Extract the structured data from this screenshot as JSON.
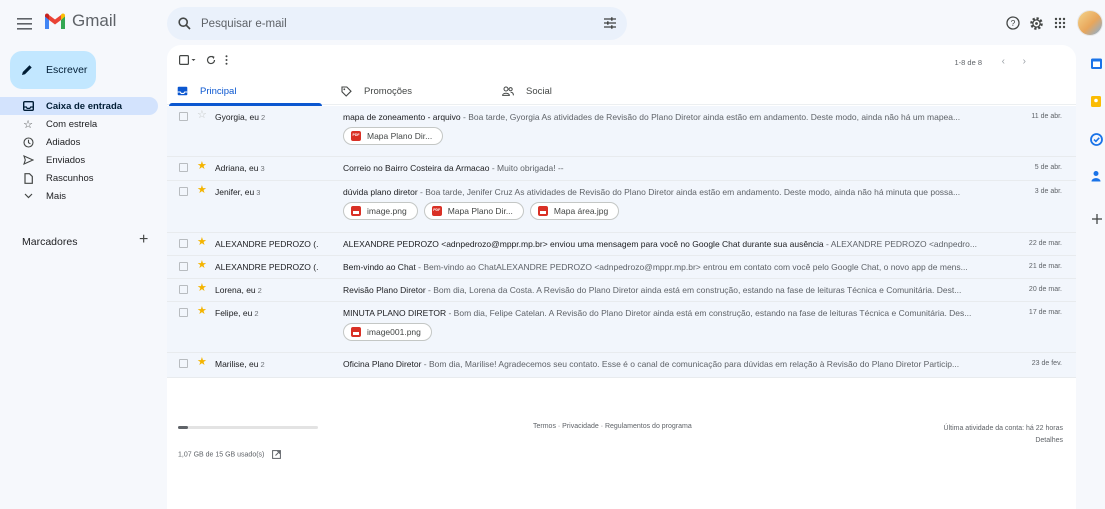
{
  "app": {
    "logo_text": "Gmail"
  },
  "search": {
    "placeholder": "Pesquisar e-mail"
  },
  "compose": {
    "label": "Escrever"
  },
  "nav": [
    {
      "label": "Caixa de entrada",
      "icon": "inbox-icon",
      "active": true
    },
    {
      "label": "Com estrela",
      "icon": "star-icon"
    },
    {
      "label": "Adiados",
      "icon": "clock-icon"
    },
    {
      "label": "Enviados",
      "icon": "send-icon"
    },
    {
      "label": "Rascunhos",
      "icon": "draft-icon"
    },
    {
      "label": "Mais",
      "icon": "chevron-down-icon"
    }
  ],
  "labels": {
    "heading": "Marcadores",
    "add": "+"
  },
  "toolbar": {
    "pager": "1-8 de 8"
  },
  "tabs": [
    {
      "label": "Principal",
      "icon": "inbox-icon",
      "active": true
    },
    {
      "label": "Promoções",
      "icon": "tag-icon"
    },
    {
      "label": "Social",
      "icon": "people-icon"
    }
  ],
  "emails": [
    {
      "sender": "Gyorgia, eu",
      "count": "2",
      "starred": false,
      "subject": "mapa de zoneamento - arquivo",
      "snippet": " - Boa tarde, Gyorgia As atividades de Revisão do Plano Diretor ainda estão em andamento. Deste modo, ainda não há um mapea...",
      "date": "11 de abr.",
      "attachments": [
        {
          "name": "Mapa Plano Dir...",
          "type": "pdf"
        }
      ]
    },
    {
      "sender": "Adriana, eu",
      "count": "3",
      "starred": true,
      "subject": "Correio no Bairro Costeira da Armacao",
      "snippet": " - Muito obrigada! --",
      "date": "5 de abr.",
      "attachments": []
    },
    {
      "sender": "Jenifer, eu",
      "count": "3",
      "starred": true,
      "subject": "dúvida plano diretor",
      "snippet": " - Boa tarde, Jenifer Cruz As atividades de Revisão do Plano Diretor ainda estão em andamento. Deste modo, ainda não há minuta que possa...",
      "date": "3 de abr.",
      "attachments": [
        {
          "name": "image.png",
          "type": "img"
        },
        {
          "name": "Mapa Plano Dir...",
          "type": "pdf"
        },
        {
          "name": "Mapa área.jpg",
          "type": "img"
        }
      ]
    },
    {
      "sender": "ALEXANDRE PEDROZO (.",
      "count": "",
      "starred": true,
      "subject": "ALEXANDRE PEDROZO <adnpedrozo@mppr.mp.br> enviou uma mensagem para você no Google Chat durante sua ausência",
      "snippet": " - ALEXANDRE PEDROZO <adnpedro...",
      "date": "22 de mar.",
      "attachments": []
    },
    {
      "sender": "ALEXANDRE PEDROZO (.",
      "count": "",
      "starred": true,
      "subject": "Bem-vindo ao Chat",
      "snippet": " - Bem-vindo ao ChatALEXANDRE PEDROZO <adnpedrozo@mppr.mp.br> entrou em contato com você pelo Google Chat, o novo app de mens...",
      "date": "21 de mar.",
      "attachments": []
    },
    {
      "sender": "Lorena, eu",
      "count": "2",
      "starred": true,
      "subject": "Revisão Plano Diretor",
      "snippet": " - Bom dia, Lorena da Costa. A Revisão do Plano Diretor ainda está em construção, estando na fase de leituras Técnica e Comunitária. Dest...",
      "date": "20 de mar.",
      "attachments": []
    },
    {
      "sender": "Felipe, eu",
      "count": "2",
      "starred": true,
      "subject": "MINUTA PLANO DIRETOR",
      "snippet": " - Bom dia, Felipe Catelan. A Revisão do Plano Diretor ainda está em construção, estando na fase de leituras Técnica e Comunitária. Des...",
      "date": "17 de mar.",
      "attachments": [
        {
          "name": "image001.png",
          "type": "img"
        }
      ]
    },
    {
      "sender": "Marilise, eu",
      "count": "2",
      "starred": true,
      "subject": "Oficina Plano Diretor",
      "snippet": " - Bom dia, Marilise! Agradecemos seu contato. Esse é o canal de comunicação para dúvidas em relação à Revisão do Plano Diretor Particip...",
      "date": "23 de fev.",
      "attachments": []
    }
  ],
  "footer": {
    "storage": "1,07 GB de 15 GB usado(s)",
    "storage_fraction": 0.07,
    "links": "Termos · Privacidade · Regulamentos do programa",
    "activity": "Última atividade da conta: há 22 horas",
    "details": "Detalhes"
  },
  "colors": {
    "accent": "#0b57d0",
    "compose_bg": "#c2e7ff",
    "active_nav": "#d3e3fd",
    "star": "#f4b400",
    "attachment_icon": "#d93025"
  }
}
